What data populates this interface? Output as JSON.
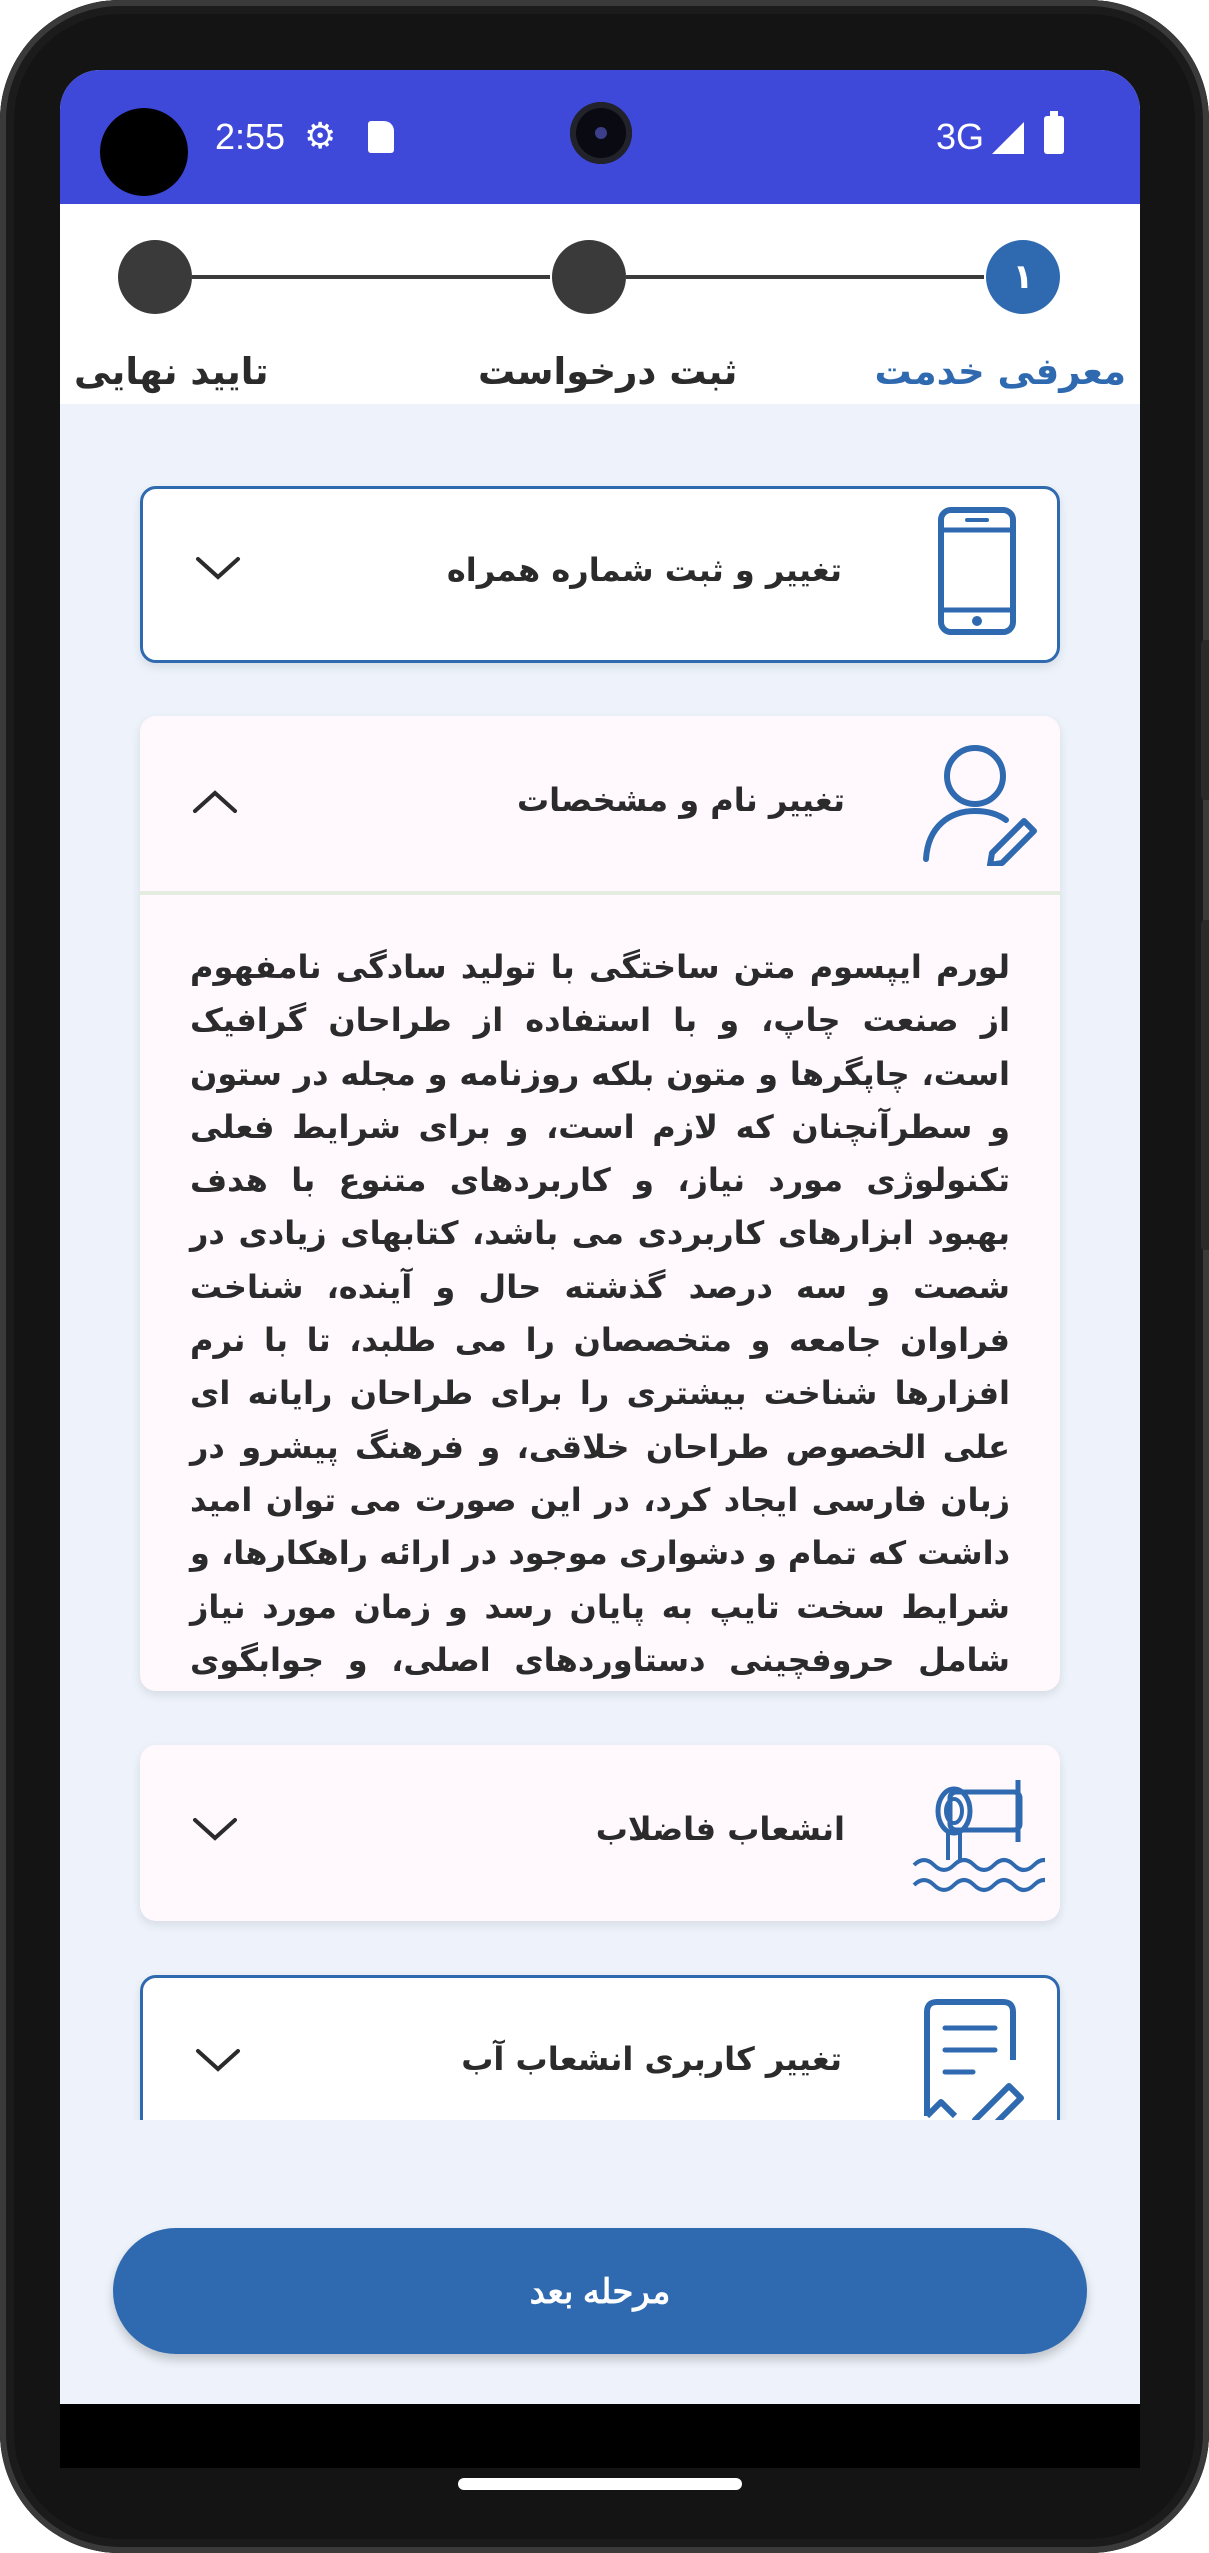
{
  "status_bar": {
    "time": "2:55",
    "network": "3G",
    "icons": [
      "gear-icon",
      "sd-card-icon",
      "signal-icon",
      "battery-icon"
    ]
  },
  "stepper": {
    "steps": [
      {
        "label": "معرفی خدمت",
        "number": "۱",
        "active": true
      },
      {
        "label": "ثبت درخواست",
        "active": false
      },
      {
        "label": "تایید نهایی",
        "active": false
      }
    ]
  },
  "cards": [
    {
      "title": "تغییر و ثبت شماره همراه",
      "icon": "mobile-phone-icon",
      "expanded": false
    },
    {
      "title": "تغییر نام و مشخصات",
      "icon": "user-edit-icon",
      "expanded": true,
      "body": "لورم ایپسوم متن ساختگی با تولید سادگی نامفهوم از صنعت چاپ، و با استفاده از طراحان گرافیک است، چاپگرها و متون بلکه روزنامه و مجله در ستون و سطرآنچنان که لازم است، و برای شرایط فعلی تکنولوژی مورد نیاز، و کاربردهای متنوع با هدف بهبود ابزارهای کاربردی می باشد، کتابهای زیادی در شصت و سه درصد گذشته حال و آینده، شناخت فراوان جامعه و متخصصان را می طلبد، تا با نرم افزارها شناخت بیشتری را برای طراحان رایانه ای علی الخصوص طراحان خلاقی، و فرهنگ پیشرو در زبان فارسی ایجاد کرد، در این صورت می توان امید داشت که تمام و دشواری موجود در ارائه راهکارها، و شرایط سخت تایپ به پایان رسد و زمان مورد نیاز شامل حروفچینی دستاوردهای اصلی، و جوابگوی سوالات پیوسته اهل دنیای موجود طراحی اساسا مورد استفاده قرار گیرد."
    },
    {
      "title": "انشعاب فاضلاب",
      "icon": "sewage-pipe-icon",
      "expanded": false
    },
    {
      "title": "تغییر کاربری انشعاب آب",
      "icon": "document-edit-icon",
      "expanded": false
    }
  ],
  "next_button": {
    "label": "مرحله بعد"
  },
  "colors": {
    "primary": "#2f6ab0",
    "status_bar": "#3f49d9",
    "background": "#eef3fb"
  }
}
